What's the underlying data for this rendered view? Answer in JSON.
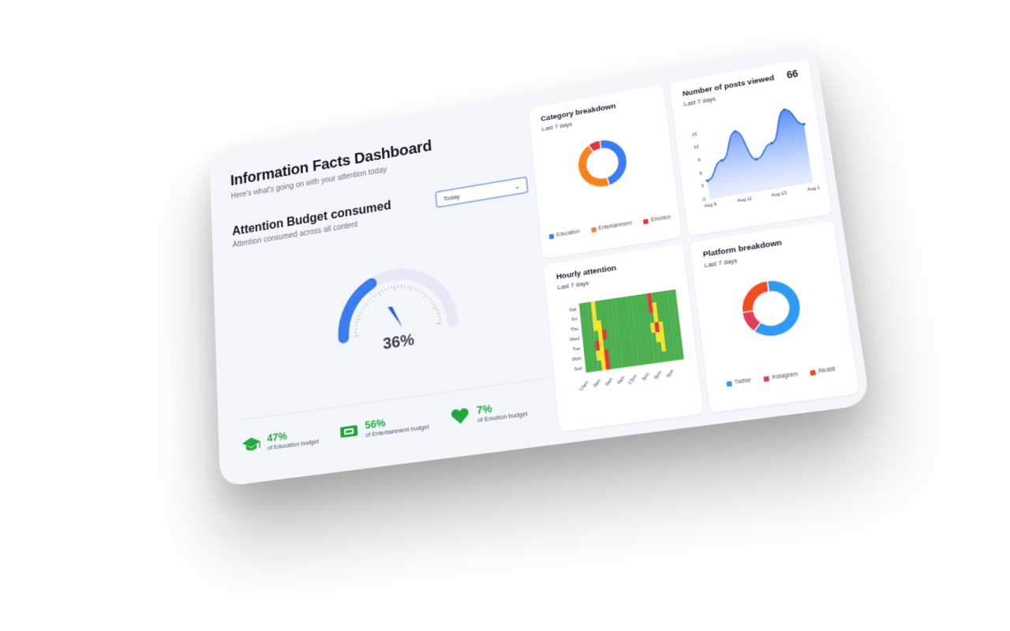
{
  "header": {
    "title": "Information Facts Dashboard",
    "subtitle": "Here's what's going on with your attention today"
  },
  "budget": {
    "title": "Attention Budget consumed",
    "subtitle": "Attention consumed across all content",
    "period_select": "Today",
    "gauge_percent": "36%",
    "gauge_value": 0.36
  },
  "stats": [
    {
      "value": "47%",
      "label": "of Education budget",
      "icon": "graduation-cap-icon"
    },
    {
      "value": "56%",
      "label": "of Entertainment budget",
      "icon": "ticket-icon"
    },
    {
      "value": "7%",
      "label": "of Emotion budget",
      "icon": "heart-icon"
    }
  ],
  "colors": {
    "blue": "#3b7cf0",
    "orange": "#f5821f",
    "red": "#e2363b",
    "green_stat": "#22a83a",
    "heat_green": "#4caf50",
    "heat_yellow": "#f4e52b",
    "heat_red": "#e53935",
    "twitter": "#2e9bf0",
    "instagram": "#e0405a",
    "reddit": "#f04d23"
  },
  "category_card": {
    "title": "Category breakdown",
    "subtitle": "Last 7 days",
    "legend": [
      "Education",
      "Entertainment",
      "Emotion"
    ]
  },
  "posts_card": {
    "title": "Number of posts viewed",
    "subtitle": "Last 7 days",
    "total": "66"
  },
  "hourly_card": {
    "title": "Hourly attention",
    "subtitle": "Last 7 days"
  },
  "platform_card": {
    "title": "Platform breakdown",
    "subtitle": "Last 7 days",
    "legend": [
      "Twitter",
      "Instagram",
      "Reddit"
    ]
  },
  "chart_data": [
    {
      "type": "pie",
      "title": "Category breakdown",
      "categories": [
        "Education",
        "Entertainment",
        "Emotion"
      ],
      "values": [
        47,
        45,
        8
      ]
    },
    {
      "type": "area",
      "title": "Number of posts viewed",
      "x": [
        "Aug 9",
        "Aug 10",
        "Aug 11",
        "Aug 12",
        "Aug 13",
        "Aug 14",
        "Aug 15"
      ],
      "x_tick_labels": [
        "Aug 9",
        "Aug 11",
        "Aug 13",
        "Aug 1"
      ],
      "values": [
        4,
        8,
        14,
        7,
        10,
        17,
        13
      ],
      "yticks": [
        0,
        3,
        6,
        9,
        12,
        15
      ],
      "ylim": [
        0,
        18
      ]
    },
    {
      "type": "heatmap",
      "title": "Hourly attention",
      "rows": [
        "Sat",
        "Fri",
        "Thu",
        "Wed",
        "Tue",
        "Mon",
        "Sun"
      ],
      "x_tick_labels": [
        "12am",
        "3am",
        "6am",
        "9am",
        "12pm",
        "3pm",
        "6pm",
        "9pm"
      ],
      "cells": [
        [
          "G",
          "G",
          "G",
          "Y",
          "G",
          "G",
          "G",
          "G",
          "G",
          "G",
          "G",
          "G",
          "G",
          "G",
          "G",
          "G",
          "G",
          "R",
          "G",
          "G",
          "G",
          "G",
          "G",
          "G"
        ],
        [
          "G",
          "G",
          "G",
          "Y",
          "G",
          "G",
          "G",
          "G",
          "G",
          "G",
          "G",
          "G",
          "G",
          "G",
          "G",
          "G",
          "G",
          "R",
          "Y",
          "G",
          "G",
          "G",
          "G",
          "G"
        ],
        [
          "G",
          "G",
          "G",
          "Y",
          "Y",
          "G",
          "G",
          "G",
          "G",
          "G",
          "G",
          "G",
          "G",
          "G",
          "G",
          "G",
          "G",
          "G",
          "Y",
          "G",
          "G",
          "G",
          "G",
          "G"
        ],
        [
          "G",
          "G",
          "G",
          "G",
          "Y",
          "R",
          "G",
          "G",
          "G",
          "G",
          "G",
          "G",
          "G",
          "G",
          "G",
          "G",
          "G",
          "Y",
          "R",
          "Y",
          "G",
          "G",
          "G",
          "G"
        ],
        [
          "G",
          "G",
          "G",
          "R",
          "Y",
          "G",
          "G",
          "G",
          "G",
          "G",
          "G",
          "G",
          "G",
          "G",
          "G",
          "G",
          "G",
          "G",
          "Y",
          "Y",
          "G",
          "G",
          "G",
          "G"
        ],
        [
          "G",
          "G",
          "G",
          "Y",
          "Y",
          "R",
          "G",
          "G",
          "G",
          "G",
          "G",
          "G",
          "G",
          "G",
          "G",
          "G",
          "G",
          "G",
          "G",
          "Y",
          "G",
          "G",
          "G",
          "G"
        ],
        [
          "G",
          "G",
          "G",
          "G",
          "Y",
          "R",
          "G",
          "G",
          "G",
          "G",
          "G",
          "G",
          "G",
          "G",
          "G",
          "G",
          "G",
          "G",
          "G",
          "G",
          "G",
          "G",
          "G",
          "G"
        ]
      ]
    },
    {
      "type": "pie",
      "title": "Platform breakdown",
      "categories": [
        "Twitter",
        "Instagram",
        "Reddit"
      ],
      "values": [
        62,
        13,
        25
      ]
    }
  ]
}
